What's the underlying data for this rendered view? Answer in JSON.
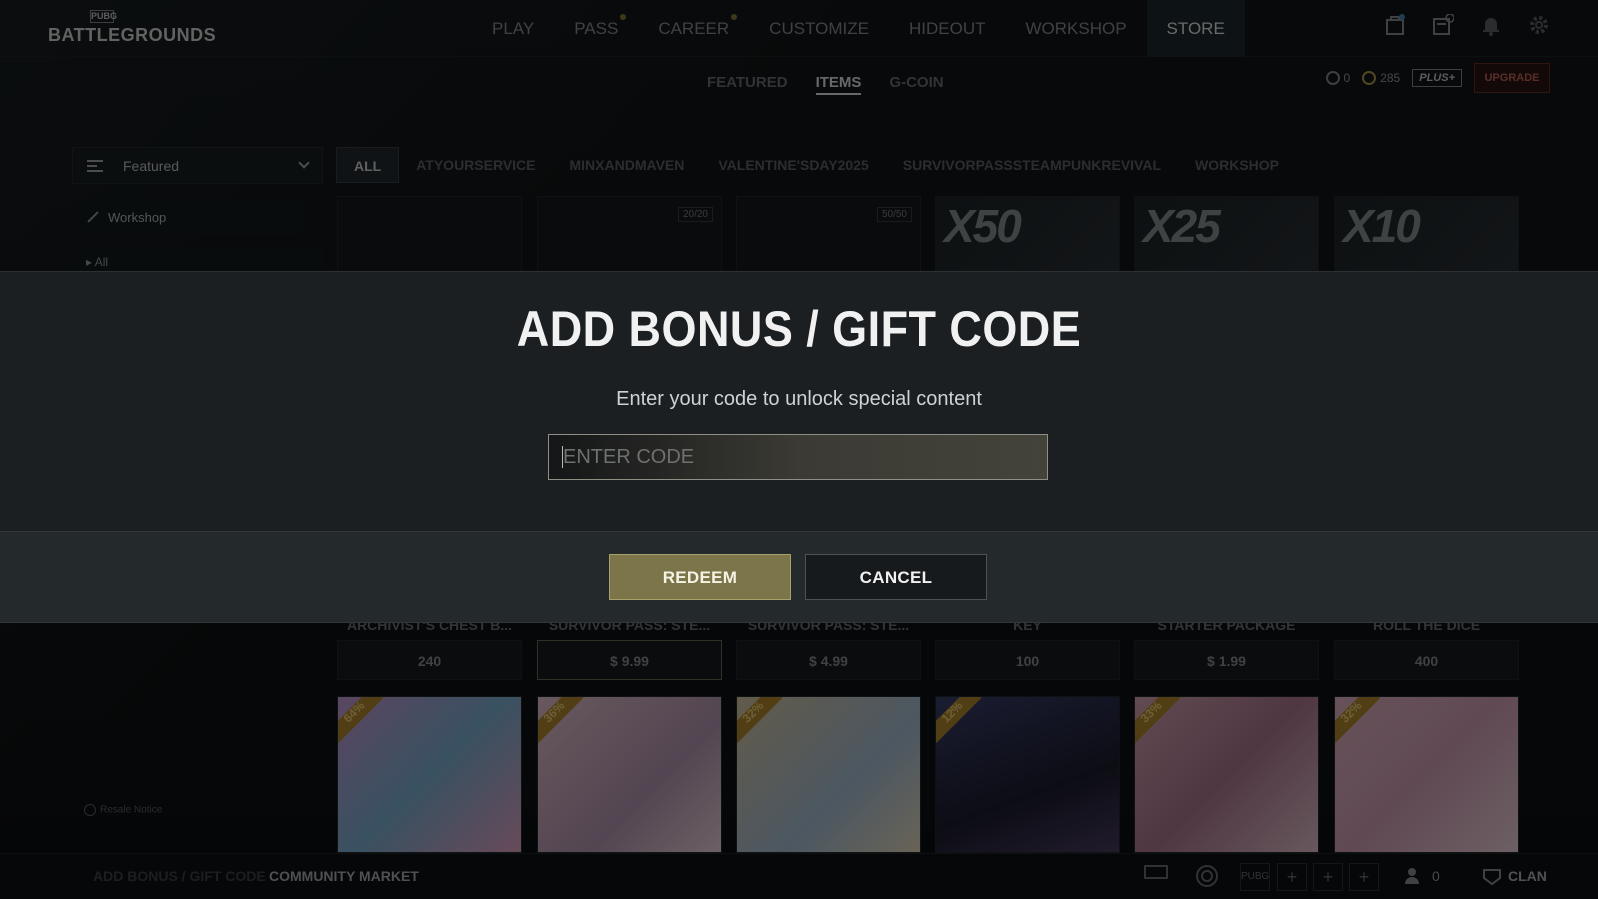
{
  "logo": {
    "small": "PUBG",
    "big": "BATTLEGROUNDS"
  },
  "main_nav": [
    {
      "label": "PLAY",
      "dot": false,
      "active": false
    },
    {
      "label": "PASS",
      "dot": true,
      "active": false
    },
    {
      "label": "CAREER",
      "dot": true,
      "active": false
    },
    {
      "label": "CUSTOMIZE",
      "dot": false,
      "active": false
    },
    {
      "label": "HIDEOUT",
      "dot": false,
      "active": false
    },
    {
      "label": "WORKSHOP",
      "dot": false,
      "active": false
    },
    {
      "label": "STORE",
      "dot": false,
      "active": true
    }
  ],
  "top_icons": [
    "shop-bag-icon",
    "mission-card-icon",
    "bell-icon",
    "gear-icon"
  ],
  "store_subnav": [
    "FEATURED",
    "ITEMS",
    "G-COIN"
  ],
  "store_subnav_active": "ITEMS",
  "currency": {
    "bp": "0",
    "gcoin": "285",
    "plus_label": "PLUS+",
    "upgrade_label": "UPGRADE"
  },
  "sort": {
    "selected": "Featured"
  },
  "sidebar": {
    "workshop": "Workshop",
    "all": "▸ All"
  },
  "category_tabs": [
    "ALL",
    "ATYOURSERVICE",
    "MINXANDMAVEN",
    "VALENTINE'SDAY2025",
    "SURVIVORPASSSTEAMPUNKREVIVAL",
    "WORKSHOP"
  ],
  "category_active": "ALL",
  "top_cards": [
    {
      "badge": "",
      "big": ""
    },
    {
      "badge": "20/20",
      "big": ""
    },
    {
      "badge": "50/50",
      "big": ""
    },
    {
      "badge": "",
      "big": "X50"
    },
    {
      "badge": "",
      "big": "X25"
    },
    {
      "badge": "",
      "big": "X10"
    }
  ],
  "card_labels": [
    "ARCHIVIST'S CHEST B...",
    "SURVIVOR PASS: STE...",
    "SURVIVOR PASS: STE...",
    "KEY",
    "STARTER PACKAGE",
    "ROLL THE DICE"
  ],
  "card_prices": [
    "240",
    "$ 9.99",
    "$ 4.99",
    "100",
    "$ 1.99",
    "400"
  ],
  "discounts": [
    "64%",
    "36%",
    "32%",
    "12%",
    "33%",
    "32%"
  ],
  "resale_notice": "Resale Notice",
  "bottom_bar": {
    "gift_code": "ADD BONUS / GIFT CODE",
    "community_market": "COMMUNITY MARKET",
    "friends_count": "0",
    "clan": "CLAN"
  },
  "modal": {
    "title": "ADD BONUS / GIFT CODE",
    "subtitle": "Enter your code to unlock special content",
    "input_placeholder": "ENTER CODE",
    "input_value": "",
    "redeem_label": "REDEEM",
    "cancel_label": "CANCEL"
  },
  "colors": {
    "redeem_bg": "#7b7549",
    "modal_bg": "#1b1f22",
    "active_nav_bg": "#1e2a30",
    "upgrade_text": "#c8665a"
  }
}
